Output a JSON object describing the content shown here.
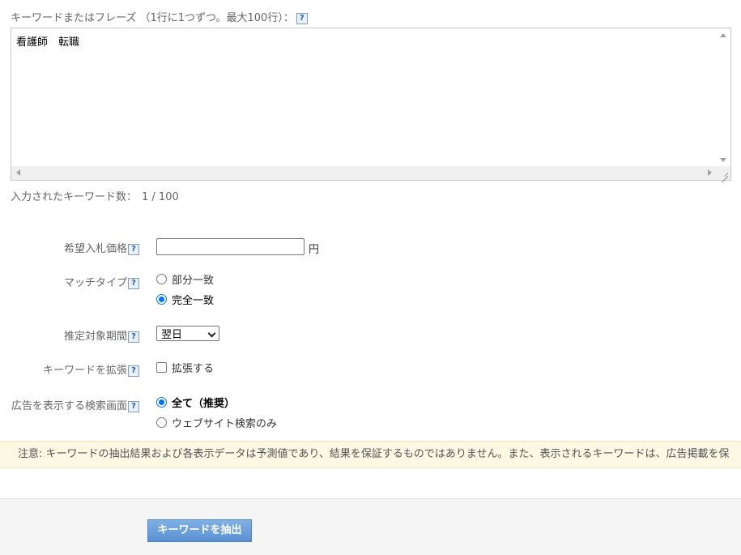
{
  "keywords": {
    "label": "キーワードまたはフレーズ （1行に1つずつ。最大100行）：",
    "help_glyph": "?",
    "textarea_value": "看護師　転職",
    "count_label": "入力されたキーワード数：",
    "count_value": "1 / 100"
  },
  "bid": {
    "label": "希望入札価格",
    "value": "",
    "unit": "円"
  },
  "match_type": {
    "label": "マッチタイプ",
    "options": [
      "部分一致",
      "完全一致"
    ],
    "selected": "完全一致"
  },
  "period": {
    "label": "推定対象期間",
    "selected": "翌日"
  },
  "expand": {
    "label": "キーワードを拡張",
    "checkbox_label": "拡張する",
    "checked": false
  },
  "screen": {
    "label": "広告を表示する検索画面",
    "options": [
      "全て（推奨）",
      "ウェブサイト検索のみ"
    ],
    "selected": "全て（推奨）"
  },
  "notice": {
    "text": "注意: キーワードの抽出結果および各表示データは予測値であり、結果を保証するものではありません。また、表示されるキーワードは、広告掲載を保"
  },
  "actions": {
    "extract_label": "キーワードを抽出"
  },
  "colors": {
    "accent": "#0075ff",
    "button": "#5a91d2",
    "notice_bg": "#fcf8e3"
  }
}
